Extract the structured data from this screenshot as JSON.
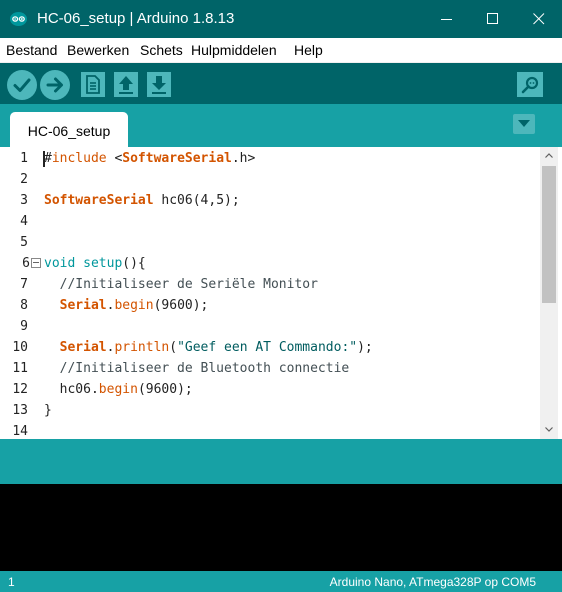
{
  "window": {
    "title": "HC-06_setup | Arduino 1.8.13"
  },
  "menu": {
    "items": [
      "Bestand",
      "Bewerken",
      "Schets",
      "Hulpmiddelen",
      "Help"
    ]
  },
  "toolbar": {
    "buttons": [
      "checkmark-icon",
      "arrow-right-icon",
      "new-file-icon",
      "upload-icon",
      "download-icon"
    ],
    "serial_monitor": "magnifier-icon"
  },
  "tabs": [
    {
      "label": "HC-06_setup",
      "active": true
    }
  ],
  "editor": {
    "line_numbers": [
      "1",
      "2",
      "3",
      "4",
      "5",
      "6",
      "7",
      "8",
      "9",
      "10",
      "11",
      "12",
      "13",
      "14"
    ],
    "lines": [
      "#include <SoftwareSerial.h>",
      "",
      "SoftwareSerial hc06(4,5);",
      "",
      "",
      "void setup(){",
      "  //Initialiseer de Seriële Monitor",
      "  Serial.begin(9600);",
      "",
      "  Serial.println(\"Geef een AT Commando:\");",
      "  //Initialiseer de Bluetooth connectie",
      "  hc06.begin(9600);",
      "}",
      ""
    ]
  },
  "status": {
    "line": "1",
    "board": "Arduino Nano, ATmega328P op COM5"
  },
  "colors": {
    "titlebar": "#006468",
    "toolbar": "#006468",
    "tabstrip": "#17a1a5",
    "button": "#4db7bb",
    "keyword": "#d35400",
    "teal_keyword": "#00979c"
  }
}
